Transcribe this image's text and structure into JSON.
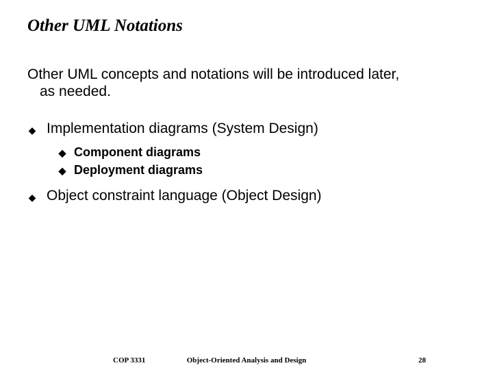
{
  "title": "Other UML Notations",
  "intro_line1": "Other UML concepts and notations will be introduced later,",
  "intro_line2": "as needed.",
  "bullets": {
    "item1": {
      "label": "Implementation diagrams (System Design)",
      "sub1": "Component diagrams",
      "sub2": "Deployment diagrams"
    },
    "item2": {
      "label": "Object constraint language (Object Design)"
    }
  },
  "footer": {
    "left": "COP 3331",
    "center": "Object-Oriented Analysis and Design",
    "right": "28"
  }
}
